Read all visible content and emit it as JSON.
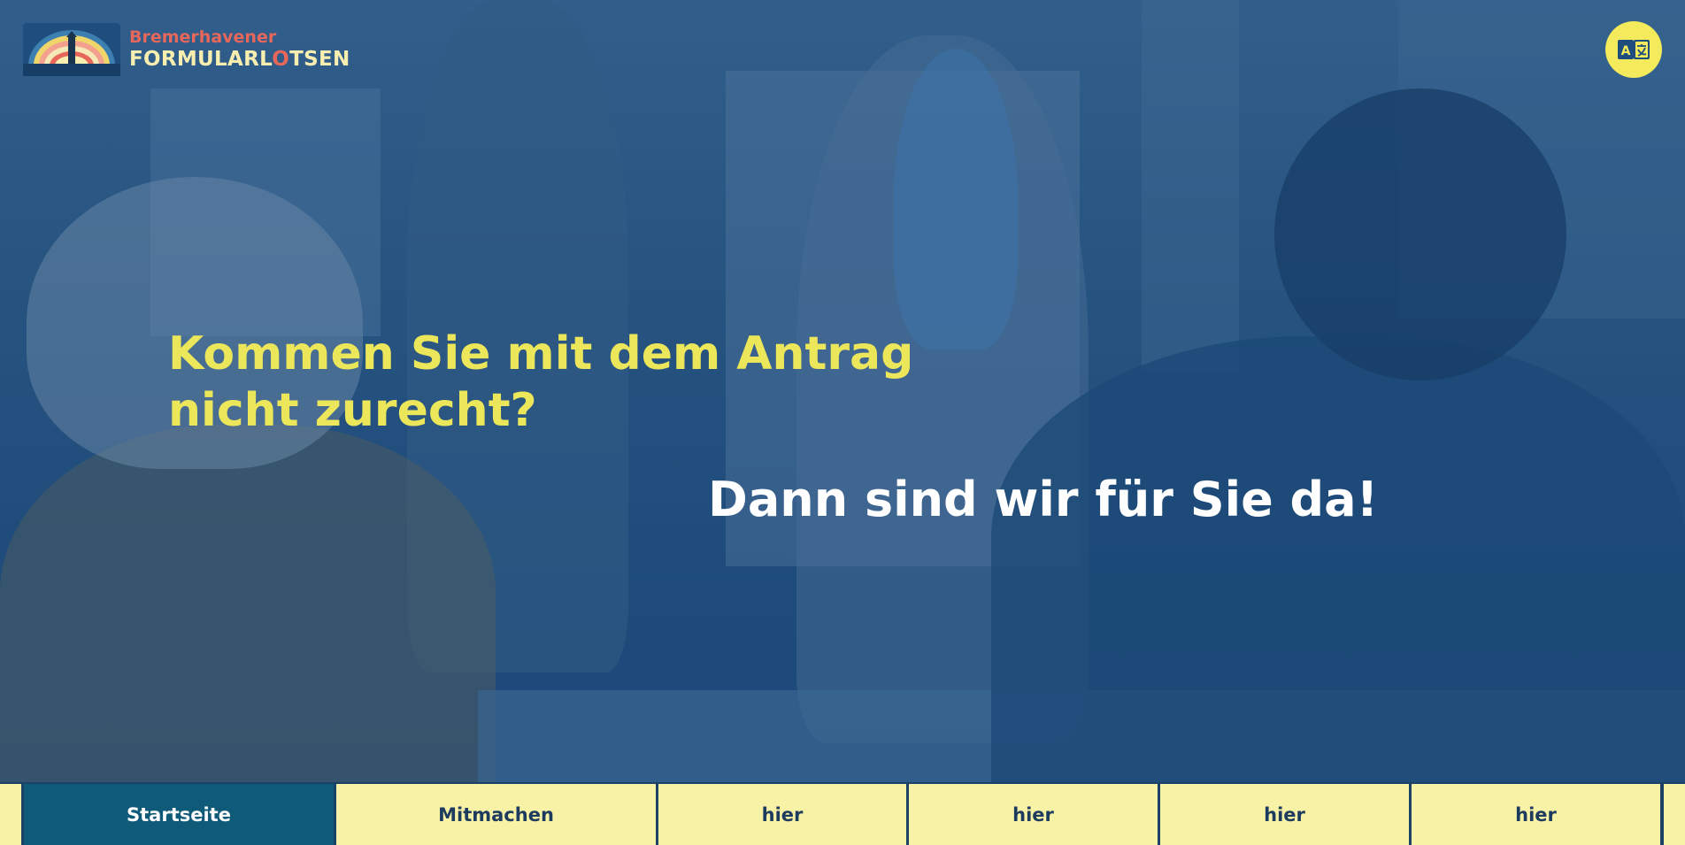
{
  "header": {
    "logo_line1": "Bremerhavener",
    "logo_line2_part1": "FORMULARL",
    "logo_line2_accent": "O",
    "logo_line2_part2": "TSEN",
    "logo_icon": "rainbow-lighthouse-icon",
    "language_button_icon": "translate-icon"
  },
  "hero": {
    "headline_line1": "Kommen Sie mit dem Antrag",
    "headline_line2": "nicht zurecht?",
    "subheadline": "Dann sind wir für Sie da!"
  },
  "nav": {
    "items": [
      {
        "label": "Startseite",
        "active": true
      },
      {
        "label": "Mitmachen",
        "active": false
      },
      {
        "label": "hier",
        "active": false
      },
      {
        "label": "hier",
        "active": false
      },
      {
        "label": "hier",
        "active": false
      },
      {
        "label": "hier",
        "active": false
      }
    ]
  },
  "colors": {
    "headline": "#ece75a",
    "subheadline": "#ffffff",
    "logo_accent": "#e8675b",
    "logo_text": "#f7eeb0",
    "nav_background": "#f7f2a6",
    "nav_active_background": "#0f5a78",
    "language_button": "#f3ea5c"
  }
}
